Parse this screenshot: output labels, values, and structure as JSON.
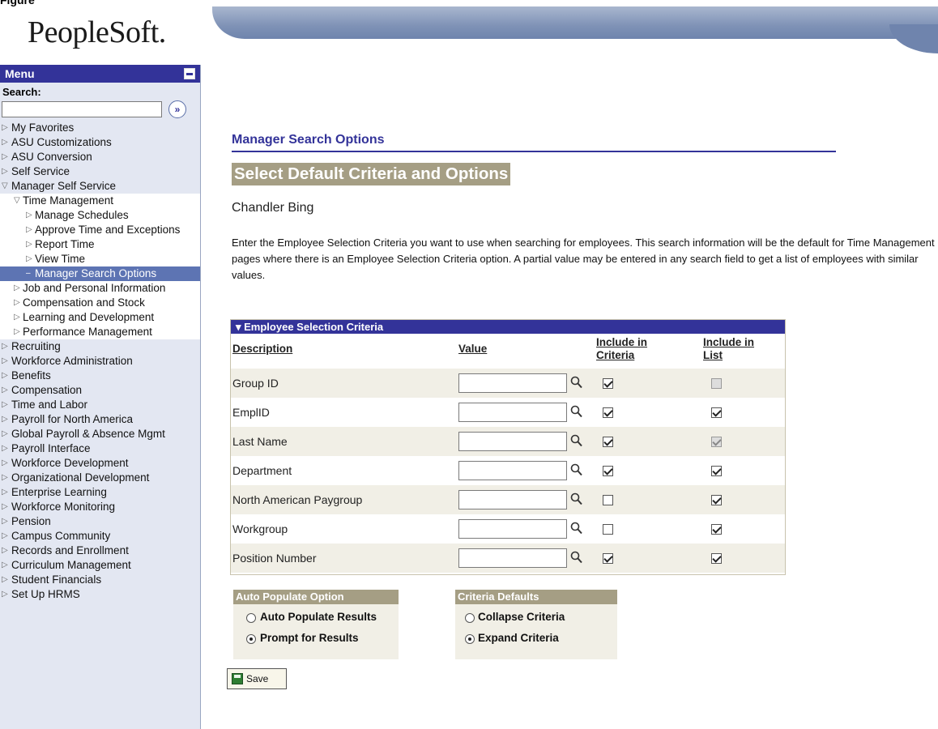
{
  "header": {
    "top_strip_text": "Figure",
    "logo": "PeopleSoft."
  },
  "sidebar": {
    "menu_title": "Menu",
    "search_label": "Search:",
    "search_value": "",
    "search_go_glyph": "»",
    "items": [
      {
        "label": "My Favorites",
        "level": 0,
        "state": "collapsed"
      },
      {
        "label": "ASU Customizations",
        "level": 0,
        "state": "collapsed"
      },
      {
        "label": "ASU Conversion",
        "level": 0,
        "state": "collapsed"
      },
      {
        "label": "Self Service",
        "level": 0,
        "state": "collapsed"
      },
      {
        "label": "Manager Self Service",
        "level": 0,
        "state": "expanded"
      },
      {
        "label": "Time Management",
        "level": 1,
        "state": "expanded"
      },
      {
        "label": "Manage Schedules",
        "level": 2,
        "state": "collapsed"
      },
      {
        "label": "Approve Time and Exceptions",
        "level": 2,
        "state": "collapsed"
      },
      {
        "label": "Report Time",
        "level": 2,
        "state": "collapsed"
      },
      {
        "label": "View Time",
        "level": 2,
        "state": "collapsed"
      },
      {
        "label": "Manager Search Options",
        "level": 2,
        "state": "selected"
      },
      {
        "label": "Job and Personal Information",
        "level": 1,
        "state": "collapsed"
      },
      {
        "label": "Compensation and Stock",
        "level": 1,
        "state": "collapsed"
      },
      {
        "label": "Learning and Development",
        "level": 1,
        "state": "collapsed"
      },
      {
        "label": "Performance Management",
        "level": 1,
        "state": "collapsed"
      },
      {
        "label": "Recruiting",
        "level": 0,
        "state": "collapsed"
      },
      {
        "label": "Workforce Administration",
        "level": 0,
        "state": "collapsed"
      },
      {
        "label": "Benefits",
        "level": 0,
        "state": "collapsed"
      },
      {
        "label": "Compensation",
        "level": 0,
        "state": "collapsed"
      },
      {
        "label": "Time and Labor",
        "level": 0,
        "state": "collapsed"
      },
      {
        "label": "Payroll for North America",
        "level": 0,
        "state": "collapsed"
      },
      {
        "label": "Global Payroll & Absence Mgmt",
        "level": 0,
        "state": "collapsed"
      },
      {
        "label": "Payroll Interface",
        "level": 0,
        "state": "collapsed"
      },
      {
        "label": "Workforce Development",
        "level": 0,
        "state": "collapsed"
      },
      {
        "label": "Organizational Development",
        "level": 0,
        "state": "collapsed"
      },
      {
        "label": "Enterprise Learning",
        "level": 0,
        "state": "collapsed"
      },
      {
        "label": "Workforce Monitoring",
        "level": 0,
        "state": "collapsed"
      },
      {
        "label": "Pension",
        "level": 0,
        "state": "collapsed"
      },
      {
        "label": "Campus Community",
        "level": 0,
        "state": "collapsed"
      },
      {
        "label": "Records and Enrollment",
        "level": 0,
        "state": "collapsed"
      },
      {
        "label": "Curriculum Management",
        "level": 0,
        "state": "collapsed"
      },
      {
        "label": "Student Financials",
        "level": 0,
        "state": "collapsed"
      },
      {
        "label": "Set Up HRMS",
        "level": 0,
        "state": "collapsed"
      }
    ]
  },
  "main": {
    "section_title": "Manager Search Options",
    "page_title": "Select Default Criteria and Options",
    "person_name": "Chandler Bing",
    "instructions": "Enter the Employee Selection Criteria you want to use when searching for employees.  This search information will be the default for Time Management pages where there is an Employee Selection Criteria option.  A partial value may be entered in any search field to get a list of employees with similar values.",
    "grid": {
      "title": "Employee Selection Criteria",
      "col_description": "Description",
      "col_value": "Value",
      "col_include_criteria": "Include in Criteria",
      "col_include_list": "Include in List",
      "rows": [
        {
          "description": "Group ID",
          "value": "",
          "include_criteria": true,
          "include_list": false,
          "list_disabled": true
        },
        {
          "description": "EmplID",
          "value": "",
          "include_criteria": true,
          "include_list": true,
          "list_disabled": false
        },
        {
          "description": "Last Name",
          "value": "",
          "include_criteria": true,
          "include_list": true,
          "list_disabled": true
        },
        {
          "description": "Department",
          "value": "",
          "include_criteria": true,
          "include_list": true,
          "list_disabled": false
        },
        {
          "description": "North American Paygroup",
          "value": "",
          "include_criteria": false,
          "include_list": true,
          "list_disabled": false
        },
        {
          "description": "Workgroup",
          "value": "",
          "include_criteria": false,
          "include_list": true,
          "list_disabled": false
        },
        {
          "description": "Position Number",
          "value": "",
          "include_criteria": true,
          "include_list": true,
          "list_disabled": false
        }
      ]
    },
    "auto_populate": {
      "title": "Auto Populate Option",
      "options": [
        "Auto Populate Results",
        "Prompt for Results"
      ],
      "selected": "Prompt for Results"
    },
    "criteria_defaults": {
      "title": "Criteria Defaults",
      "options": [
        "Collapse Criteria",
        "Expand Criteria"
      ],
      "selected": "Expand Criteria"
    },
    "save_label": "Save"
  },
  "icons": {
    "search_go": "circle-arrow-icon",
    "lookup": "magnifier-icon",
    "save": "floppy-disk-icon"
  },
  "colors": {
    "nav_blue": "#333399",
    "title_tan": "#a59e84",
    "sidebar_bg": "#e3e7f2",
    "selected_item": "#5d74b3"
  }
}
